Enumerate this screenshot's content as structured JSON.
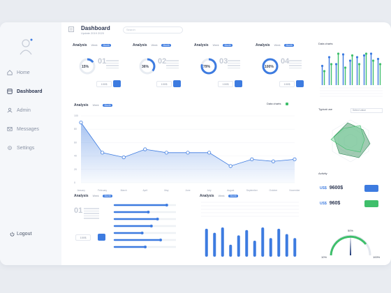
{
  "header": {
    "title": "Dashboard",
    "subtitle": "Update 2019 2020",
    "search_placeholder": "Search"
  },
  "sidebar": {
    "items": [
      {
        "label": "Home",
        "icon": "home-icon"
      },
      {
        "label": "Dashboard",
        "icon": "dashboard-icon",
        "active": true
      },
      {
        "label": "Admin",
        "icon": "admin-icon"
      },
      {
        "label": "Messages",
        "icon": "messages-icon"
      },
      {
        "label": "Settings",
        "icon": "settings-icon"
      }
    ],
    "logout": "Logout"
  },
  "analysis_cards": [
    {
      "title": "Analysis",
      "period": "Week",
      "tab": "Month",
      "percent": 15,
      "percent_label": "15%",
      "number": "01",
      "btn": "100$"
    },
    {
      "title": "Analysis",
      "period": "Week",
      "tab": "Month",
      "percent": 36,
      "percent_label": "36%",
      "number": "02",
      "btn": "100$"
    },
    {
      "title": "Analysis",
      "period": "Week",
      "tab": "Month",
      "percent": 79,
      "percent_label": "79%",
      "number": "03",
      "btn": "100$"
    },
    {
      "title": "Analysis",
      "period": "Week",
      "tab": "Month",
      "percent": 100,
      "percent_label": "100%",
      "number": "04",
      "btn": "100$"
    }
  ],
  "main_chart": {
    "title": "Analysis",
    "period": "Week",
    "tab": "Month",
    "legend_label": "Data charts",
    "chart_data": {
      "type": "area",
      "categories": [
        "January",
        "February",
        "March",
        "April",
        "May",
        "June",
        "July",
        "August",
        "September",
        "October",
        "November"
      ],
      "values": [
        90,
        45,
        38,
        50,
        45,
        45,
        45,
        25,
        35,
        32,
        35
      ],
      "ylim": [
        0,
        100
      ],
      "y_ticks": [
        "100",
        "80",
        "60",
        "40",
        "20",
        "0"
      ]
    }
  },
  "data_charts": {
    "title": "Data charts",
    "chart_data": {
      "type": "bar",
      "series": [
        {
          "name": "blue",
          "values": [
            55,
            80,
            60,
            88,
            70,
            80,
            85,
            90,
            75
          ]
        },
        {
          "name": "green",
          "values": [
            40,
            60,
            90,
            50,
            85,
            60,
            90,
            70,
            60
          ]
        }
      ],
      "ylim": [
        0,
        100
      ]
    }
  },
  "radar": {
    "title": "Typical use",
    "select": "Select value"
  },
  "activity": {
    "title": "Activity",
    "rows": [
      {
        "unit": "US$",
        "value": "9600$",
        "color": "#3d7be0"
      },
      {
        "unit": "US$",
        "value": "960$",
        "color": "#3fbf6b"
      }
    ],
    "gauge_value": "50%",
    "gauge_min": "10%",
    "gauge_max": "100%"
  },
  "bottom_left": {
    "title": "Analysis",
    "period": "Week",
    "tab": "Month",
    "number": "01",
    "btn": "100$",
    "bars": [
      0.85,
      0.55,
      0.7,
      0.6,
      0.45,
      0.75,
      0.5
    ]
  },
  "bottom_mid": {
    "title": "Analysis",
    "period": "Week",
    "tab": "Month",
    "chart_data": {
      "type": "bar",
      "values": [
        95,
        80,
        100,
        35,
        70,
        90,
        50,
        100,
        60,
        95,
        75,
        60
      ],
      "ylim": [
        0,
        100
      ]
    }
  },
  "colors": {
    "accent": "#3d7be0",
    "green": "#3fbf6b",
    "bg": "#e9ecf1"
  }
}
